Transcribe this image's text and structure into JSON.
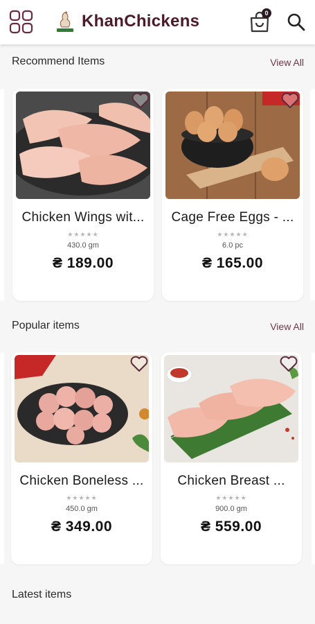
{
  "header": {
    "brand": "KhanChickens",
    "cart_count": "0"
  },
  "sections": {
    "recommended": {
      "title": "Recommend Items",
      "view_all": "View All",
      "items": [
        {
          "name": "Chicken Wings wit...",
          "rating_stars": "★★★★★",
          "weight": "430.0 gm",
          "price": "₴ 189.00"
        },
        {
          "name": "Cage Free Eggs - ...",
          "rating_stars": "★★★★★",
          "weight": "6.0 pc",
          "price": "₴ 165.00"
        }
      ]
    },
    "popular": {
      "title": "Popular items",
      "view_all": "View All",
      "items": [
        {
          "name": "Chicken Boneless ...",
          "rating_stars": "★★★★★",
          "weight": "450.0 gm",
          "price": "₴ 349.00"
        },
        {
          "name": "Chicken Breast ...",
          "rating_stars": "★★★★★",
          "weight": "900.0 gm",
          "price": "₴ 559.00"
        }
      ]
    },
    "latest": {
      "title": "Latest items"
    }
  },
  "colors": {
    "brand": "#4b1b2b",
    "accent_icon": "#6a2a3e",
    "background": "#f6f6f6"
  },
  "icons": [
    "grid-icon",
    "logo-icon",
    "cart-icon",
    "search-icon",
    "heart-icon"
  ]
}
